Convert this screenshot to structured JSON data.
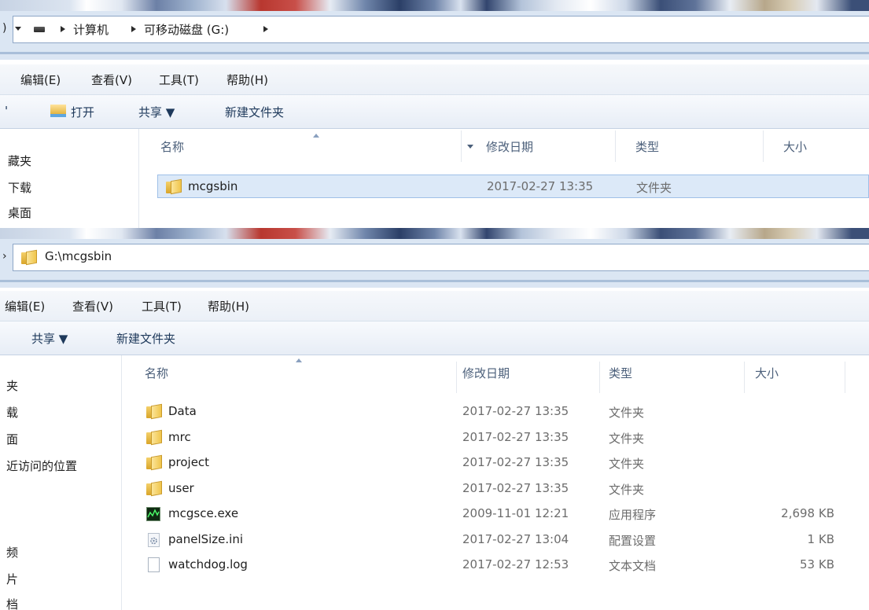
{
  "top": {
    "breadcrumb": [
      "计算机",
      "可移动磁盘 (G:)"
    ],
    "menu": [
      "编辑(E)",
      "查看(V)",
      "工具(T)",
      "帮助(H)"
    ],
    "toolbar": {
      "open": "打开",
      "share": "共享 ▼",
      "new_folder": "新建文件夹"
    },
    "nav": [
      "藏夹",
      "下载",
      "桌面"
    ],
    "columns": [
      "名称",
      "修改日期",
      "类型",
      "大小"
    ],
    "rows": [
      {
        "name": "mcgsbin",
        "date": "2017-02-27 13:35",
        "type": "文件夹",
        "size": "",
        "icon": "folder-icon"
      }
    ]
  },
  "bottom": {
    "address": "G:\\mcgsbin",
    "menu": [
      "编辑(E)",
      "查看(V)",
      "工具(T)",
      "帮助(H)"
    ],
    "toolbar": {
      "share": "共享 ▼",
      "new_folder": "新建文件夹"
    },
    "nav": [
      "夹",
      "载",
      "面",
      "近访问的位置",
      "频",
      "片",
      "档"
    ],
    "columns": [
      "名称",
      "修改日期",
      "类型",
      "大小"
    ],
    "rows": [
      {
        "name": "Data",
        "date": "2017-02-27 13:35",
        "type": "文件夹",
        "size": "",
        "icon": "folder-icon"
      },
      {
        "name": "mrc",
        "date": "2017-02-27 13:35",
        "type": "文件夹",
        "size": "",
        "icon": "folder-icon"
      },
      {
        "name": "project",
        "date": "2017-02-27 13:35",
        "type": "文件夹",
        "size": "",
        "icon": "folder-icon"
      },
      {
        "name": "user",
        "date": "2017-02-27 13:35",
        "type": "文件夹",
        "size": "",
        "icon": "folder-icon"
      },
      {
        "name": "mcgsce.exe",
        "date": "2009-11-01 12:21",
        "type": "应用程序",
        "size": "2,698 KB",
        "icon": "exe-icon"
      },
      {
        "name": "panelSize.ini",
        "date": "2017-02-27 13:04",
        "type": "配置设置",
        "size": "1 KB",
        "icon": "ini-icon"
      },
      {
        "name": "watchdog.log",
        "date": "2017-02-27 12:53",
        "type": "文本文档",
        "size": "53 KB",
        "icon": "text-file-icon"
      }
    ]
  }
}
